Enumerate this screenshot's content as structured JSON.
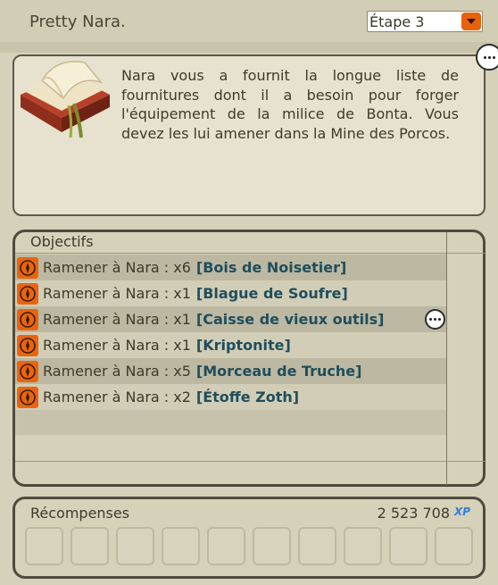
{
  "header": {
    "title": "Pretty Nara.",
    "step_selected": "Étape 3"
  },
  "description": {
    "text": "Nara vous a fournit la longue liste de fournitures dont il a besoin pour forger l'équipement de la milice de Bonta. Vous devez les lui amener dans la Mine des Porcos."
  },
  "objectives": {
    "title": "Objectifs",
    "items": [
      {
        "prefix": "Ramener à Nara : x6",
        "item": "[Bois de Noisetier]"
      },
      {
        "prefix": "Ramener à Nara : x1",
        "item": "[Blague de Soufre]"
      },
      {
        "prefix": "Ramener à Nara : x1",
        "item": "[Caisse de vieux outils]"
      },
      {
        "prefix": "Ramener à Nara : x1",
        "item": "[Kriptonite]"
      },
      {
        "prefix": "Ramener à Nara : x5",
        "item": "[Morceau de Truche]"
      },
      {
        "prefix": "Ramener à Nara : x2",
        "item": "[Étoffe Zoth]"
      }
    ]
  },
  "rewards": {
    "title": "Récompenses",
    "xp": "2 523 708",
    "xp_label": "XP"
  },
  "colors": {
    "accent": "#e8620c",
    "item_link": "#1f4e5d",
    "panel_border": "#4f4b3d"
  }
}
